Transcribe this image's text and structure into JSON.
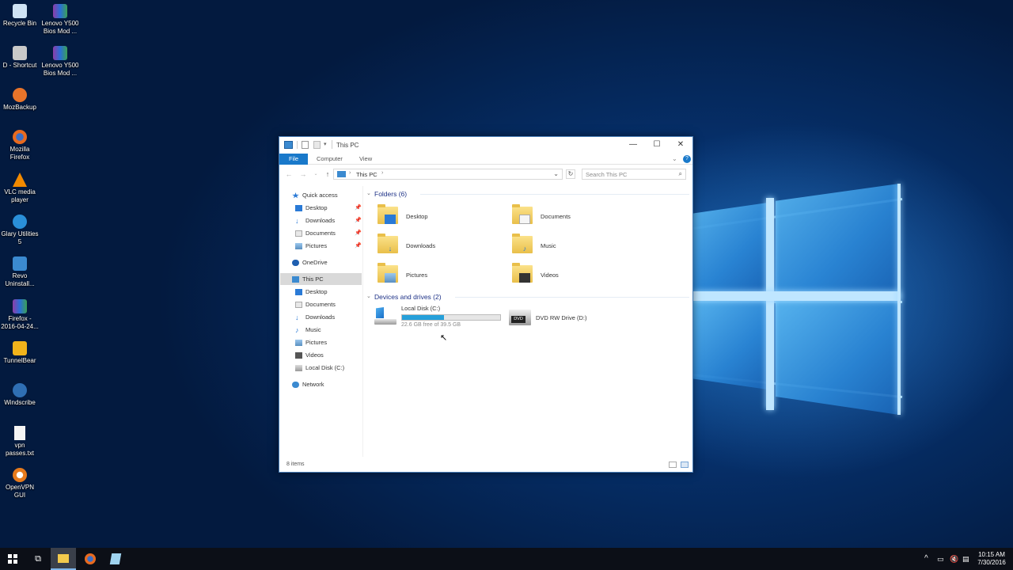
{
  "desktop": {
    "icons": [
      {
        "label": "Recycle Bin",
        "icon": "recycle-bin-icon",
        "color": "#cfe3f5"
      },
      {
        "label": "Lenovo Y500 Bios Mod ...",
        "icon": "winrar-archive-icon",
        "color": "#8e3da8"
      },
      {
        "label": "D - Shortcut",
        "icon": "drive-shortcut-icon",
        "color": "#c9c9c9"
      },
      {
        "label": "Lenovo Y500 Bios Mod ...",
        "icon": "winrar-archive-icon",
        "color": "#8e3da8"
      },
      {
        "label": "MozBackup",
        "icon": "mozbackup-icon",
        "color": "#e8742a"
      },
      {
        "label": "Mozilla Firefox",
        "icon": "firefox-icon",
        "color": "#e86a1f"
      },
      {
        "label": "VLC media player",
        "icon": "vlc-icon",
        "color": "#f28a00"
      },
      {
        "label": "Glary Utilities 5",
        "icon": "glary-utilities-icon",
        "color": "#2a8fd8"
      },
      {
        "label": "Revo Uninstall...",
        "icon": "revo-uninstaller-icon",
        "color": "#3b8ad0"
      },
      {
        "label": "Firefox - 2016-04-24...",
        "icon": "winrar-archive-icon",
        "color": "#8e3da8"
      },
      {
        "label": "TunnelBear",
        "icon": "tunnelbear-icon",
        "color": "#f2b31b"
      },
      {
        "label": "Windscribe",
        "icon": "windscribe-icon",
        "color": "#2f6fb4"
      },
      {
        "label": "vpn passes.txt",
        "icon": "text-file-icon",
        "color": "#f5f5f5"
      },
      {
        "label": "OpenVPN GUI",
        "icon": "openvpn-icon",
        "color": "#e67a1c"
      }
    ]
  },
  "explorer": {
    "title": "This PC",
    "ribbon_tabs": {
      "file": "File",
      "computer": "Computer",
      "view": "View"
    },
    "address": {
      "crumb": "This PC"
    },
    "search": {
      "placeholder": "Search This PC"
    },
    "nav": {
      "quick_access": "Quick access",
      "qa_items": [
        "Desktop",
        "Downloads",
        "Documents",
        "Pictures"
      ],
      "onedrive": "OneDrive",
      "this_pc": "This PC",
      "pc_items": [
        "Desktop",
        "Documents",
        "Downloads",
        "Music",
        "Pictures",
        "Videos",
        "Local Disk (C:)"
      ],
      "network": "Network"
    },
    "folders_header": "Folders (6)",
    "folders": [
      {
        "label": "Desktop",
        "icon": "desktop-folder-icon"
      },
      {
        "label": "Documents",
        "icon": "documents-folder-icon"
      },
      {
        "label": "Downloads",
        "icon": "downloads-folder-icon"
      },
      {
        "label": "Music",
        "icon": "music-folder-icon"
      },
      {
        "label": "Pictures",
        "icon": "pictures-folder-icon"
      },
      {
        "label": "Videos",
        "icon": "videos-folder-icon"
      }
    ],
    "devices_header": "Devices and drives (2)",
    "drives": [
      {
        "label": "Local Disk (C:)",
        "free_text": "22.6 GB free of 39.5 GB",
        "used_fraction": 0.43,
        "icon": "windows-drive-icon"
      },
      {
        "label": "DVD RW Drive (D:)",
        "icon": "dvd-drive-icon",
        "badge": "DVD"
      }
    ],
    "status": {
      "item_count": "8 items"
    },
    "accent": "#1979ca",
    "drive_bar_color": "#26a0da"
  },
  "taskbar": {
    "clock_time": "10:15 AM",
    "clock_date": "7/30/2016"
  }
}
